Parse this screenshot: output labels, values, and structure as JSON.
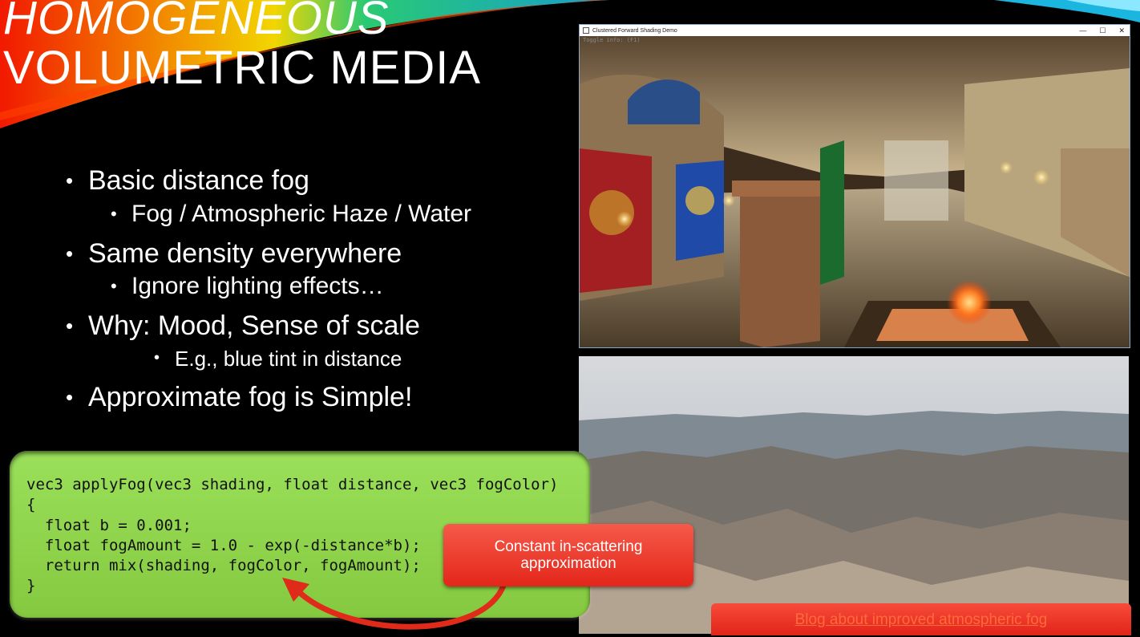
{
  "slide": {
    "title_line1": "HOMOGENEOUS",
    "title_line2": "VOLUMETRIC MEDIA"
  },
  "bullets": [
    {
      "level": 1,
      "text": "Basic distance fog"
    },
    {
      "level": 2,
      "text": "Fog / Atmospheric Haze / Water"
    },
    {
      "level": 1,
      "text": "Same density everywhere"
    },
    {
      "level": 2,
      "text": "Ignore lighting effects…"
    },
    {
      "level": 1,
      "text": "Why: Mood, Sense of scale"
    },
    {
      "level": 3,
      "text": "E.g., blue tint in distance"
    },
    {
      "level": 1,
      "text": "Approximate fog is Simple!"
    }
  ],
  "code": {
    "lines": [
      "vec3 applyFog(vec3 shading, float distance, vec3 fogColor)",
      "{",
      "  float b = 0.001;",
      "  float fogAmount = 1.0 - exp(-distance*b);",
      "  return mix(shading, fogColor, fogAmount);",
      "}"
    ]
  },
  "callout": {
    "text": "Constant in-scattering approximation"
  },
  "demo_window": {
    "title": "Clustered Forward Shading Demo",
    "overlay": "Toggle info: (F1)",
    "controls": [
      "—",
      "☐",
      "✕"
    ]
  },
  "link": {
    "text": "Blog about improved atmospheric fog"
  },
  "colors": {
    "code_box": "#8fd44c",
    "callout": "#ee3a2a",
    "link_button": "#ea3322",
    "link_text": "#ff6a3a"
  }
}
